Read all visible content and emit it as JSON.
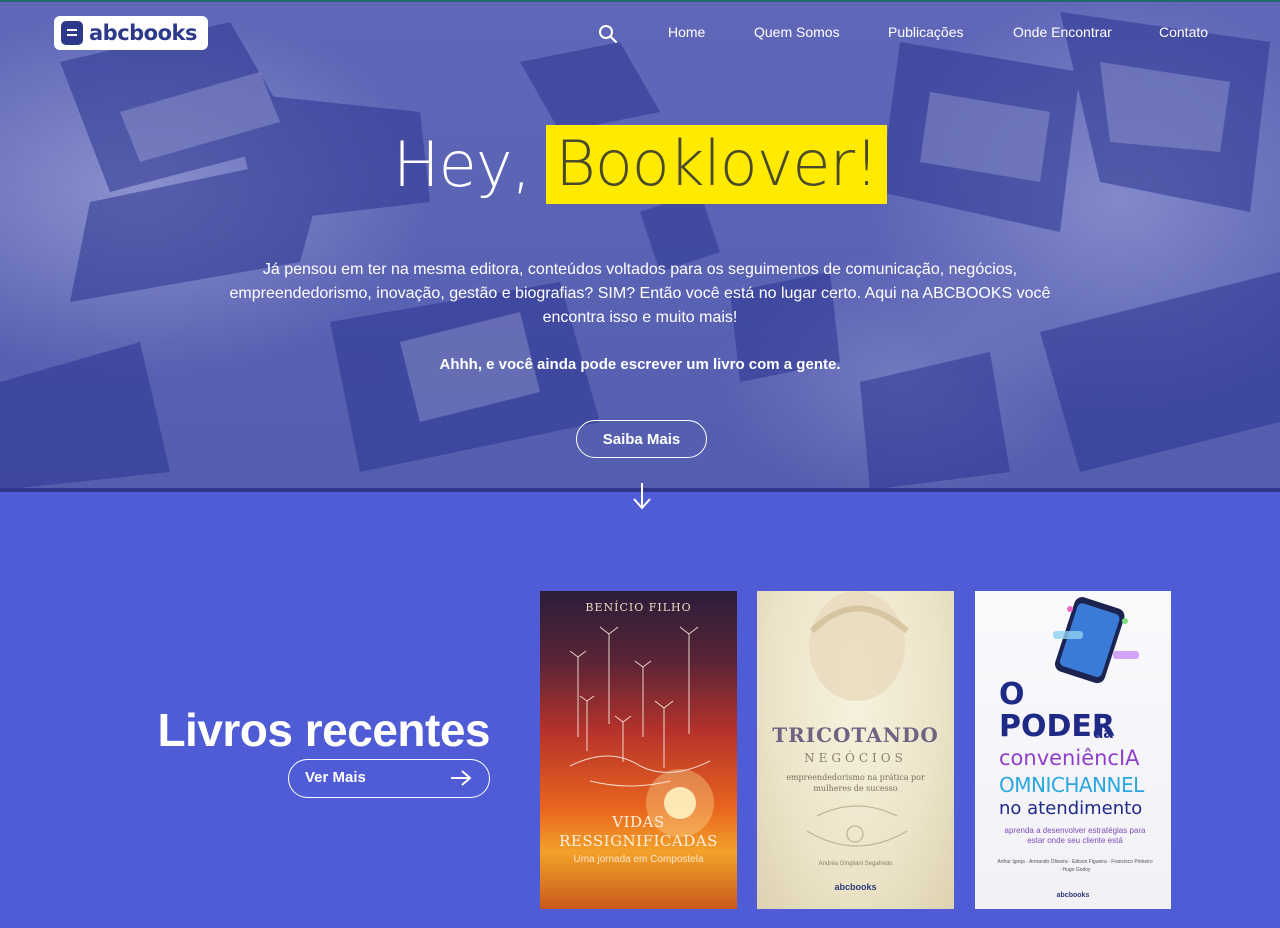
{
  "brand": {
    "logo_text": "abcbooks"
  },
  "nav": {
    "search_icon": "search-icon",
    "items": [
      "Home",
      "Quem Somos",
      "Publicações",
      "Onde Encontrar",
      "Contato"
    ]
  },
  "hero": {
    "title_prefix": "Hey,",
    "title_highlight": "Booklover!",
    "paragraph": "Já pensou em ter na mesma editora, conteúdos voltados para os seguimentos de comunicação, negócios, empreendedorismo, inovação, gestão e biografias? SIM? Então você está no lugar certo. Aqui na ABCBOOKS você encontra isso e muito mais!",
    "strong_line": "Ahhh, e você ainda pode escrever um livro com a gente.",
    "cta_label": "Saiba Mais",
    "scroll_icon": "arrow-down-icon",
    "highlight_color": "#ffea00"
  },
  "recent": {
    "title": "Livros recentes",
    "more_label": "Ver Mais",
    "more_icon": "arrow-right-icon",
    "background_color": "#4f5cd6",
    "books": [
      {
        "author": "BENÍCIO FILHO",
        "title": "VIDAS RESSIGNIFICADAS",
        "subtitle": "Uma jornada em Compostela"
      },
      {
        "title": "TRICOTANDO",
        "subtitle": "NEGÓCIOS",
        "tagline": "empreendedorismo na prática por mulheres de sucesso",
        "author": "Andréa Gingliani Segafredo",
        "publisher": "abcbooks"
      },
      {
        "title_o": "O",
        "title_poder": "PODER",
        "title_da": "da",
        "title_conv": "conveniêncIA",
        "title_omni": "OMNICHANNEL",
        "title_atend": "no atendimento",
        "tagline": "aprenda a desenvolver estratégias para estar onde seu cliente está",
        "authors": "Arthur Igreja · Armando Oliveira · Edison Figueira · Francisco Pinheiro · Hugo Godoy",
        "publisher": "abcbooks"
      }
    ]
  }
}
